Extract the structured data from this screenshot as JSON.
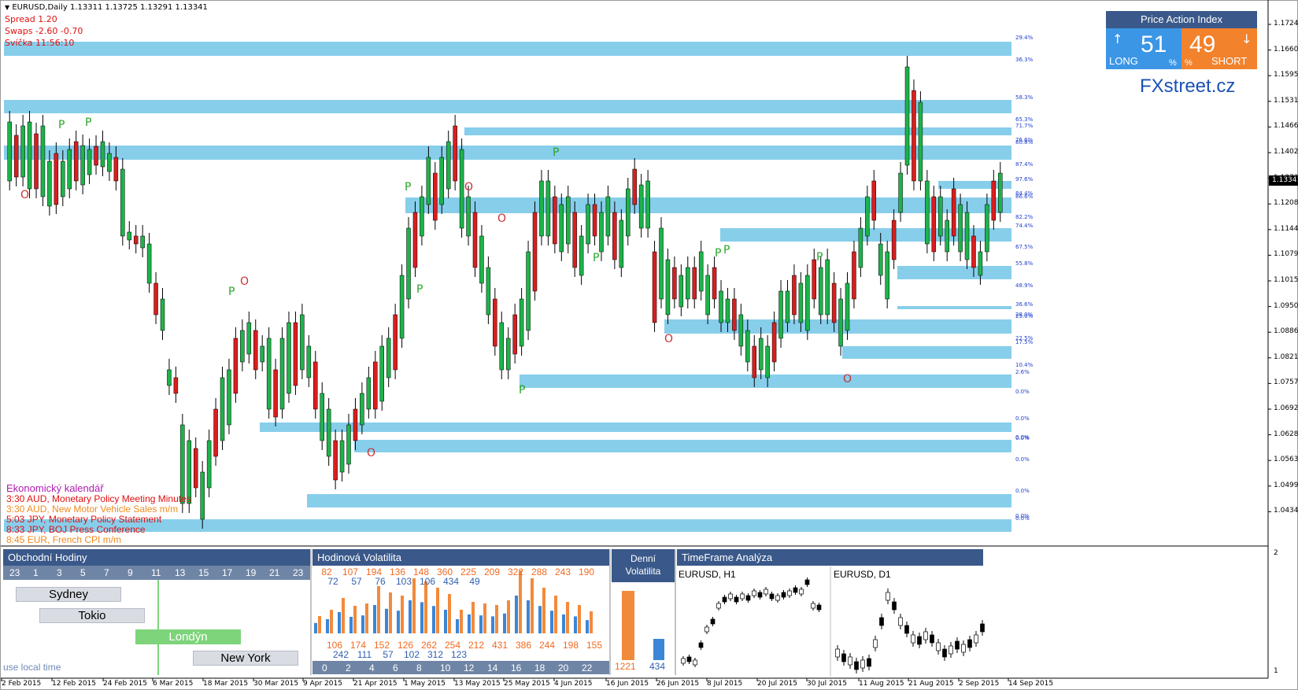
{
  "header": {
    "symbol_line": "EURUSD,Daily  1.13311 1.13725 1.13291 1.13341",
    "spread": "Spread  1.20",
    "swaps": "Swaps  -2.60 -0.70",
    "candle_timer": "Svíčka  11:56:10"
  },
  "price_axis": [
    "1.17245",
    "1.16600",
    "1.15955",
    "1.15310",
    "1.14665",
    "1.14020",
    "1.13341",
    "1.12730",
    "1.12085",
    "1.11440",
    "1.10795",
    "1.10150",
    "1.09505",
    "1.08860",
    "1.08215",
    "1.07570",
    "1.06925",
    "1.06280",
    "1.05635",
    "1.04990",
    "1.04345"
  ],
  "current_price": "1.13341",
  "date_axis": [
    "2 Feb 2015",
    "12 Feb 2015",
    "24 Feb 2015",
    "6 Mar 2015",
    "18 Mar 2015",
    "30 Mar 2015",
    "9 Apr 2015",
    "21 Apr 2015",
    "1 May 2015",
    "13 May 2015",
    "25 May 2015",
    "4 Jun 2015",
    "16 Jun 2015",
    "26 Jun 2015",
    "8 Jul 2015",
    "20 Jul 2015",
    "30 Jul 2015",
    "11 Aug 2015",
    "21 Aug 2015",
    "2 Sep 2015",
    "14 Sep 2015"
  ],
  "zone_percents": [
    "29.4%",
    "36.3%",
    "58.3%",
    "65.3%",
    "71.7%",
    "76.6%",
    "80.8%",
    "87.4%",
    "97.6%",
    "84.4%",
    "86.6%",
    "82.2%",
    "74.4%",
    "67.5%",
    "55.8%",
    "48.9%",
    "36.6%",
    "28.0%",
    "25.0%",
    "22.5%",
    "17.5%",
    "10.4%",
    "2.6%",
    "0.0%",
    "0.0%",
    "0.0%",
    "0.0%",
    "0.0%",
    "0.0%",
    "0.0%",
    "0.0%"
  ],
  "price_action_index": {
    "title": "Price Action Index",
    "long_value": "51",
    "long_label": "LONG",
    "long_pct": "%",
    "short_value": "49",
    "short_label": "SHORT",
    "short_pct": "%",
    "long_color": "#3b96e6",
    "short_color": "#f2822c",
    "up_arrow": "↑",
    "down_arrow": "↓"
  },
  "brand": "FXstreet.cz",
  "calendar": {
    "title": "Ekonomický kalendář",
    "items": [
      {
        "text": "3:30 AUD, Monetary Policy Meeting Minutes",
        "color": "#e01010"
      },
      {
        "text": "3:30 AUD, New Motor Vehicle Sales m/m",
        "color": "#f08a20"
      },
      {
        "text": "5:03 JPY, Monetary Policy Statement",
        "color": "#e01010"
      },
      {
        "text": "8:33 JPY, BOJ Press Conference",
        "color": "#e01010"
      },
      {
        "text": "8:45 EUR, French CPI m/m",
        "color": "#f08a20"
      }
    ]
  },
  "trading_hours": {
    "title": "Obchodní Hodiny",
    "hours": [
      "23",
      "1",
      "3",
      "5",
      "7",
      "9",
      "11",
      "13",
      "15",
      "17",
      "19",
      "21",
      "23"
    ],
    "sessions": [
      "Sydney",
      "Tokio",
      "Londýn",
      "New York"
    ],
    "local_time_note": "use local time"
  },
  "hourly_volatility": {
    "title": "Hodinová Volatilita",
    "top_orange": [
      "82",
      "107",
      "194",
      "136",
      "148",
      "360",
      "225",
      "209",
      "322",
      "288",
      "243",
      "190"
    ],
    "top_blue": [
      "72",
      "57",
      "76",
      "103",
      "106",
      "434",
      "49"
    ],
    "bottom_orange": [
      "106",
      "174",
      "152",
      "126",
      "262",
      "254",
      "212",
      "431",
      "386",
      "244",
      "198",
      "155"
    ],
    "bottom_blue": [
      "242",
      "111",
      "57",
      "102",
      "312",
      "123"
    ],
    "hour_axis": [
      "0",
      "2",
      "4",
      "6",
      "8",
      "10",
      "12",
      "14",
      "16",
      "18",
      "20",
      "22"
    ]
  },
  "daily_volatility": {
    "title_line1": "Denní",
    "title_line2": "Volatilita",
    "orange_value": "1221",
    "blue_value": "434"
  },
  "timeframe_analysis": {
    "title": "TimeFrame Analýza",
    "chart1": "EURUSD, H1",
    "chart2": "EURUSD, D1"
  },
  "indicator_axis": {
    "top": "2",
    "bottom": "1"
  },
  "colors": {
    "zone": "#87ceeb",
    "bull": "#1db34a",
    "bear": "#d91e1e",
    "panel_header": "#3a598a",
    "hour_bar": "#6f85a6",
    "marker_p": "#2aa52a",
    "marker_o": "#c83232"
  }
}
